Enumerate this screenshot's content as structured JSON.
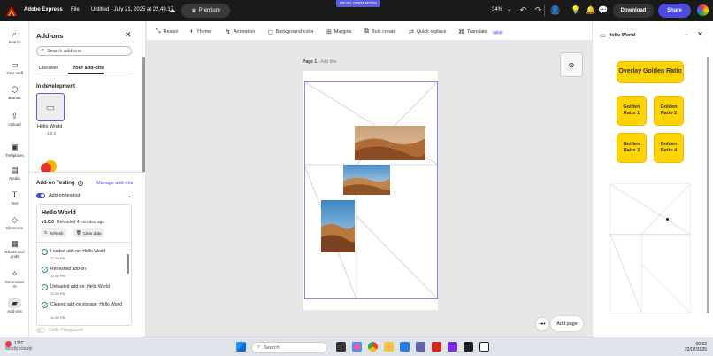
{
  "topbar": {
    "app_name": "Adobe Express",
    "file_menu": "File",
    "doc_title": "Untitled - July 21, 2025 at 22.49.17",
    "premium": "Premium",
    "dev_mode": "DEVELOPER MODE",
    "zoom": "34%",
    "download": "Download",
    "share": "Share"
  },
  "rail": [
    {
      "label": "Search",
      "icon": "search-icon"
    },
    {
      "label": "Your stuff",
      "icon": "folder-icon"
    },
    {
      "label": "Brands",
      "icon": "brand-icon"
    },
    {
      "label": "Upload",
      "icon": "upload-icon"
    },
    {
      "label": "Templates",
      "icon": "templates-icon"
    },
    {
      "label": "Media",
      "icon": "media-icon"
    },
    {
      "label": "Text",
      "icon": "text-icon"
    },
    {
      "label": "Elements",
      "icon": "elements-icon"
    },
    {
      "label": "Charts and grids",
      "icon": "charts-icon"
    },
    {
      "label": "Generative AI",
      "icon": "generative-ai-icon"
    },
    {
      "label": "Add-ons",
      "icon": "addons-icon"
    }
  ],
  "addons": {
    "title": "Add-ons",
    "search_placeholder": "Search add-ons",
    "tabs": [
      "Discover",
      "Your add-ons"
    ],
    "section": "In development",
    "addon_name": "Hello World",
    "addon_version": "1.0.0"
  },
  "testing": {
    "title": "Add-on Testing",
    "manage": "Manage add-ons",
    "toggle_label": "Add-on testing",
    "card_title": "Hello World",
    "card_version": "v1.0.0",
    "card_reloaded": "Reloaded 4 minutes ago",
    "refresh": "Refresh",
    "clear": "Clear data",
    "logs": [
      {
        "text": "Loaded add-on: Hello World",
        "time": "11:56 PM"
      },
      {
        "text": "Refreshed add-on",
        "time": "11:56 PM"
      },
      {
        "text": "Unloaded add-on: Hello World",
        "time": "11:56 PM"
      },
      {
        "text": "Cleared add-on storage: Hello World",
        "time": "11:56 PM"
      }
    ],
    "code_playground": "Code Playground"
  },
  "toolbar": [
    {
      "label": "Resize",
      "icon": "resize-icon"
    },
    {
      "label": "Theme",
      "icon": "theme-icon"
    },
    {
      "label": "Animation",
      "icon": "animation-icon"
    },
    {
      "label": "Background color",
      "icon": "background-color-icon"
    },
    {
      "label": "Margins",
      "icon": "margins-icon"
    },
    {
      "label": "Bulk create",
      "icon": "bulk-create-icon"
    },
    {
      "label": "Quick replace",
      "icon": "quick-replace-icon"
    },
    {
      "label": "Translate",
      "icon": "translate-icon"
    }
  ],
  "toolbar_new": "NEW",
  "canvas": {
    "page_label": "Page 1",
    "page_sub": " - Add title",
    "add_page": "Add page"
  },
  "rightpanel": {
    "title": "Hello World",
    "overlay": "Overlay Golden Ratio",
    "buttons": [
      "Golden Ratio 1",
      "Golden Ratio 2",
      "Golden Ratio 3",
      "Golden Ratio 4"
    ]
  },
  "taskbar": {
    "temp": "17°C",
    "weather": "Mostly cloudy",
    "search": "Search",
    "time": "00:02",
    "date": "22/07/2025"
  },
  "colors": {
    "accent": "#4b4bdc",
    "golden": "#ffd400",
    "topbar": "#1a1a1a"
  }
}
